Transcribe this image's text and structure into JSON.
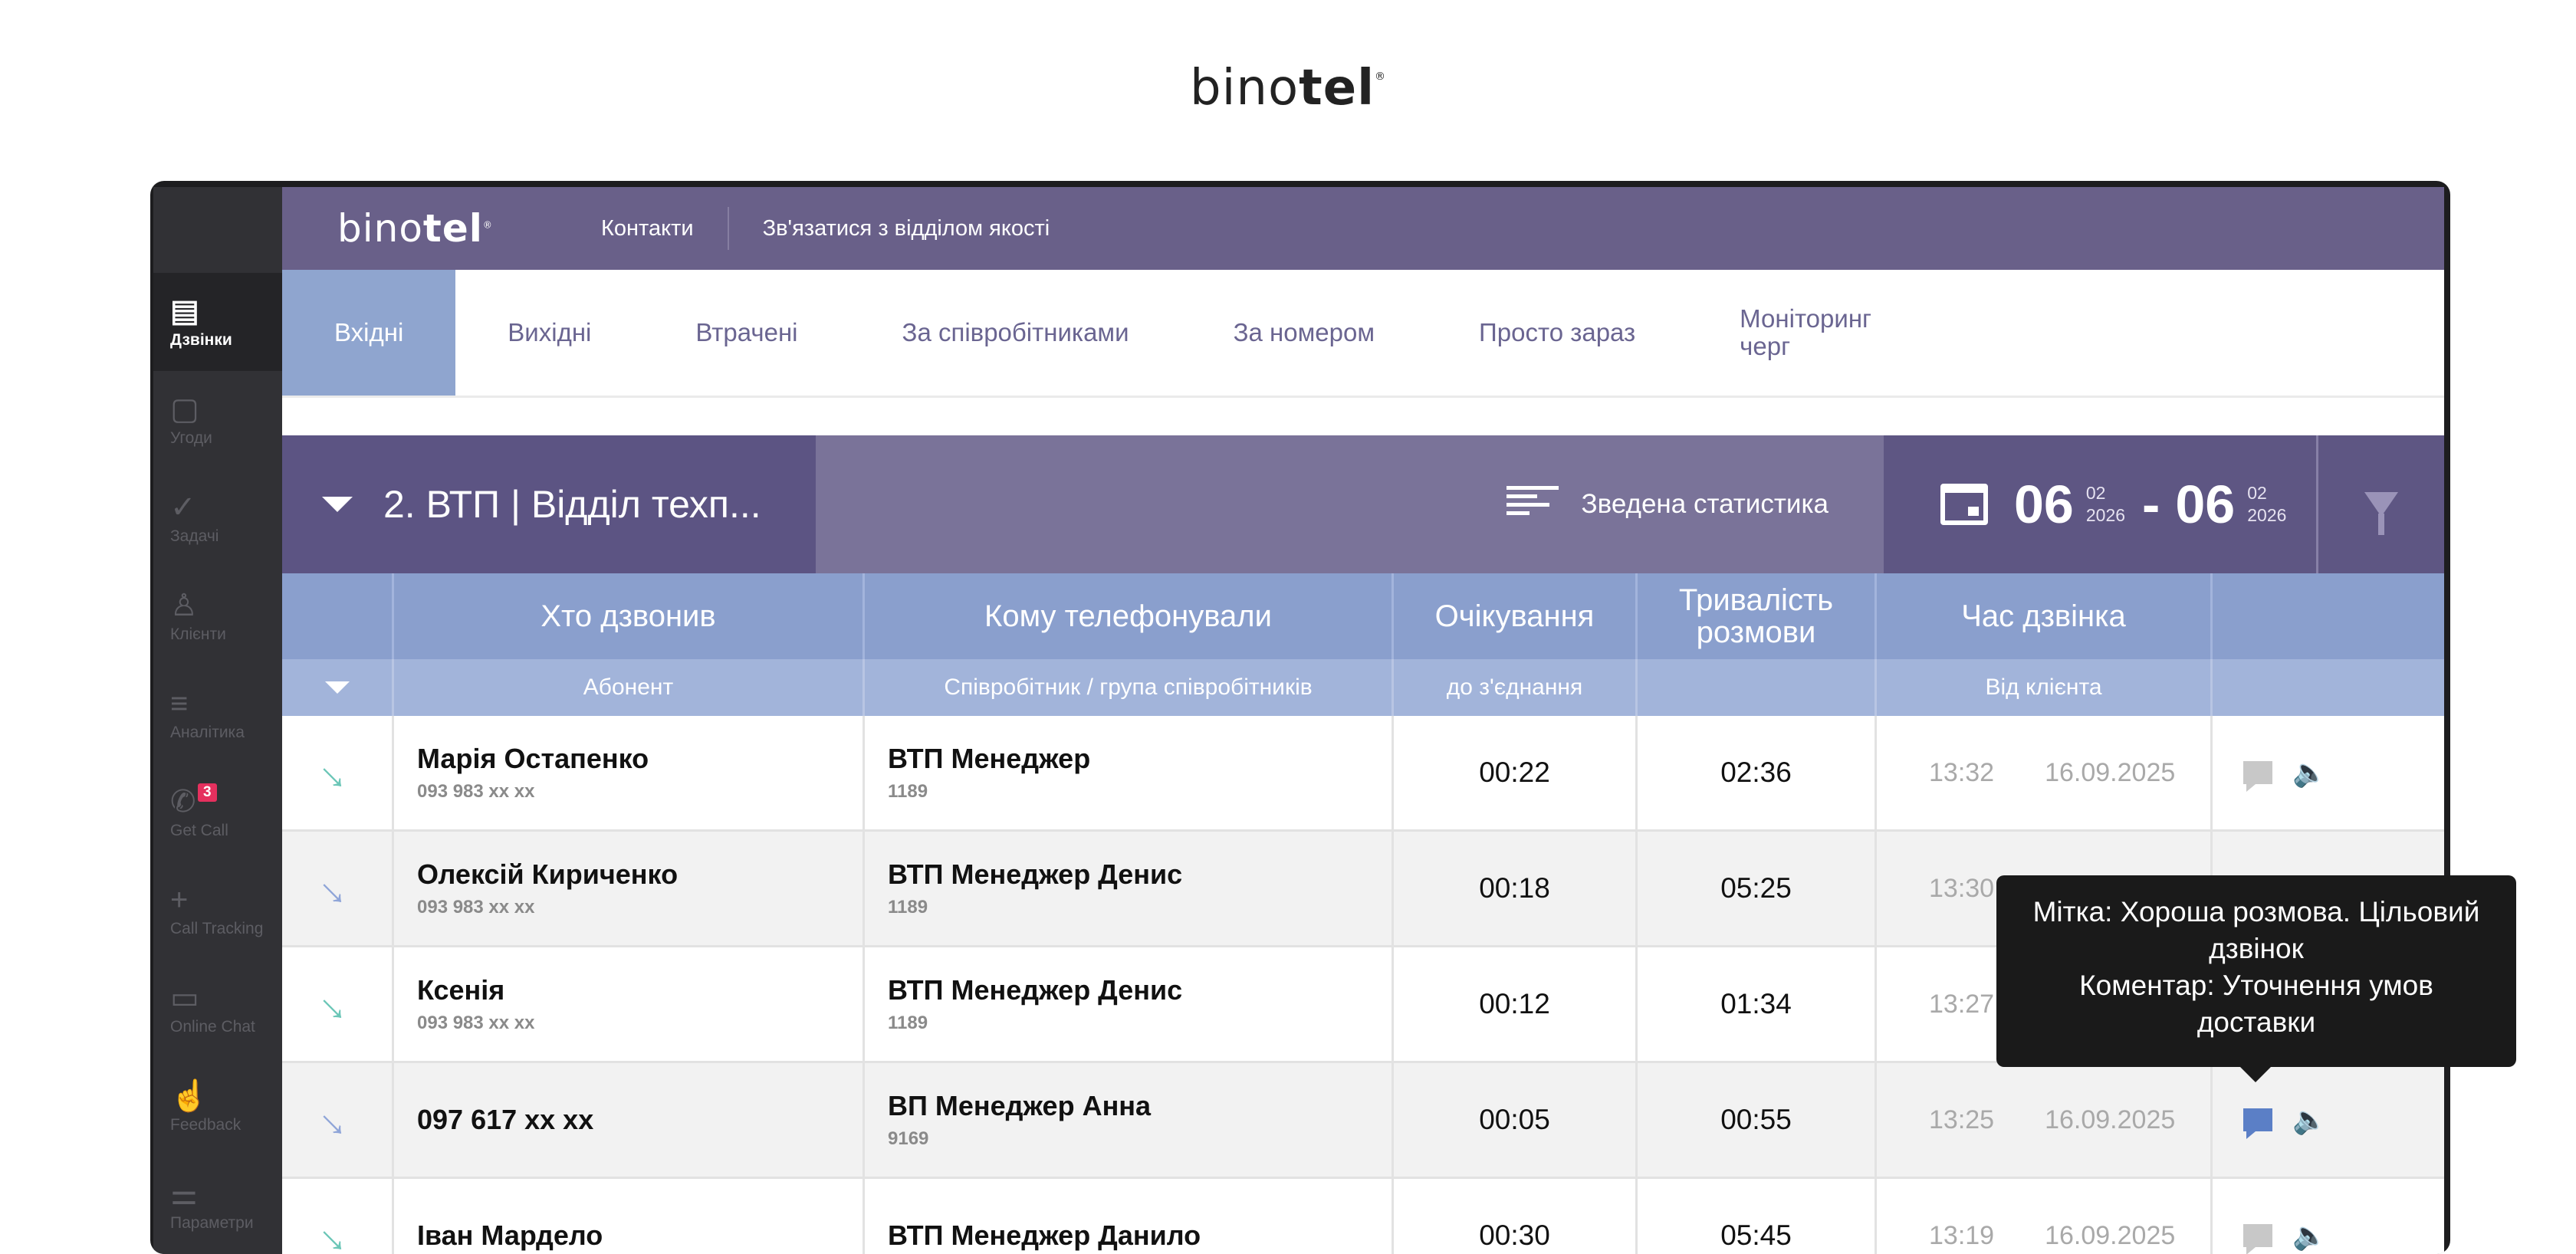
{
  "brand": {
    "top_logo_light": "bino",
    "top_logo_bold": "tel",
    "reg": "®"
  },
  "sidebar": {
    "items": [
      {
        "label": "Дзвінки",
        "icon": "calls-icon",
        "active": true
      },
      {
        "label": "Угоди",
        "icon": "deals-icon"
      },
      {
        "label": "Задачі",
        "icon": "check-icon"
      },
      {
        "label": "Клієнти",
        "icon": "user-icon"
      },
      {
        "label": "Аналітика",
        "icon": "analytics-icon"
      },
      {
        "label": "Get Call",
        "icon": "phone-icon",
        "badge": "3"
      },
      {
        "label": "Call Tracking",
        "icon": "crosshair-icon"
      },
      {
        "label": "Online Chat",
        "icon": "chat-icon"
      },
      {
        "label": "Feedback",
        "icon": "thumb-icon"
      },
      {
        "label": "Параметри",
        "icon": "sliders-icon"
      }
    ]
  },
  "header": {
    "logo_light": "bino",
    "logo_bold": "tel",
    "reg": "®",
    "links": [
      "Контакти",
      "Зв'язатися з відділом якості"
    ]
  },
  "tabs": [
    "Вхідні",
    "Вихідні",
    "Втрачені",
    "За співробітниками",
    "За номером",
    "Просто зараз",
    "Моніторинг черг"
  ],
  "filter": {
    "group": "2.  ВТП |  Відділ техп...",
    "stats_label": "Зведена статистика",
    "date_from_day": "06",
    "date_from_month": "02",
    "date_from_year": "2026",
    "dash": "-",
    "date_to_day": "06",
    "date_to_month": "02",
    "date_to_year": "2026"
  },
  "table": {
    "headers": [
      "Хто дзвонив",
      "Кому телефонували",
      "Очікування",
      "Тривалість розмови",
      "Час дзвінка"
    ],
    "subheaders": [
      "Абонент",
      "Співробітник / група співробітників",
      "до з'єднання",
      "",
      "Від клієнта"
    ],
    "rows": [
      {
        "caller": "Марія Остапенко",
        "caller_phone": "093 983 xx xx",
        "callee": "ВТП Менеджер",
        "callee_ext": "1189",
        "wait": "00:22",
        "duration": "02:36",
        "time": "13:32",
        "date": "16.09.2025",
        "arrow": "green"
      },
      {
        "caller": "Олексій Кириченко",
        "caller_phone": "093 983 xx xx",
        "callee": "ВТП Менеджер Денис",
        "callee_ext": "1189",
        "wait": "00:18",
        "duration": "05:25",
        "time": "13:30",
        "date": "",
        "arrow": "blue"
      },
      {
        "caller": "Ксенія",
        "caller_phone": "093 983 xx xx",
        "callee": "ВТП Менеджер Денис",
        "callee_ext": "1189",
        "wait": "00:12",
        "duration": "01:34",
        "time": "13:27",
        "date": "",
        "arrow": "green"
      },
      {
        "caller": "097 617 xx xx",
        "caller_phone": "",
        "callee": "ВП Менеджер Анна",
        "callee_ext": "9169",
        "wait": "00:05",
        "duration": "00:55",
        "time": "13:25",
        "date": "16.09.2025",
        "arrow": "blue"
      },
      {
        "caller": "Іван Мардело",
        "caller_phone": "",
        "callee": "ВТП Менеджер Данило",
        "callee_ext": "",
        "wait": "00:30",
        "duration": "05:45",
        "time": "13:19",
        "date": "16.09.2025",
        "arrow": "green"
      }
    ]
  },
  "tooltip": {
    "line1": "Мітка: Хороша розмова. Цільовий дзвінок",
    "line2": "Коментар: Уточнення умов доставки"
  }
}
